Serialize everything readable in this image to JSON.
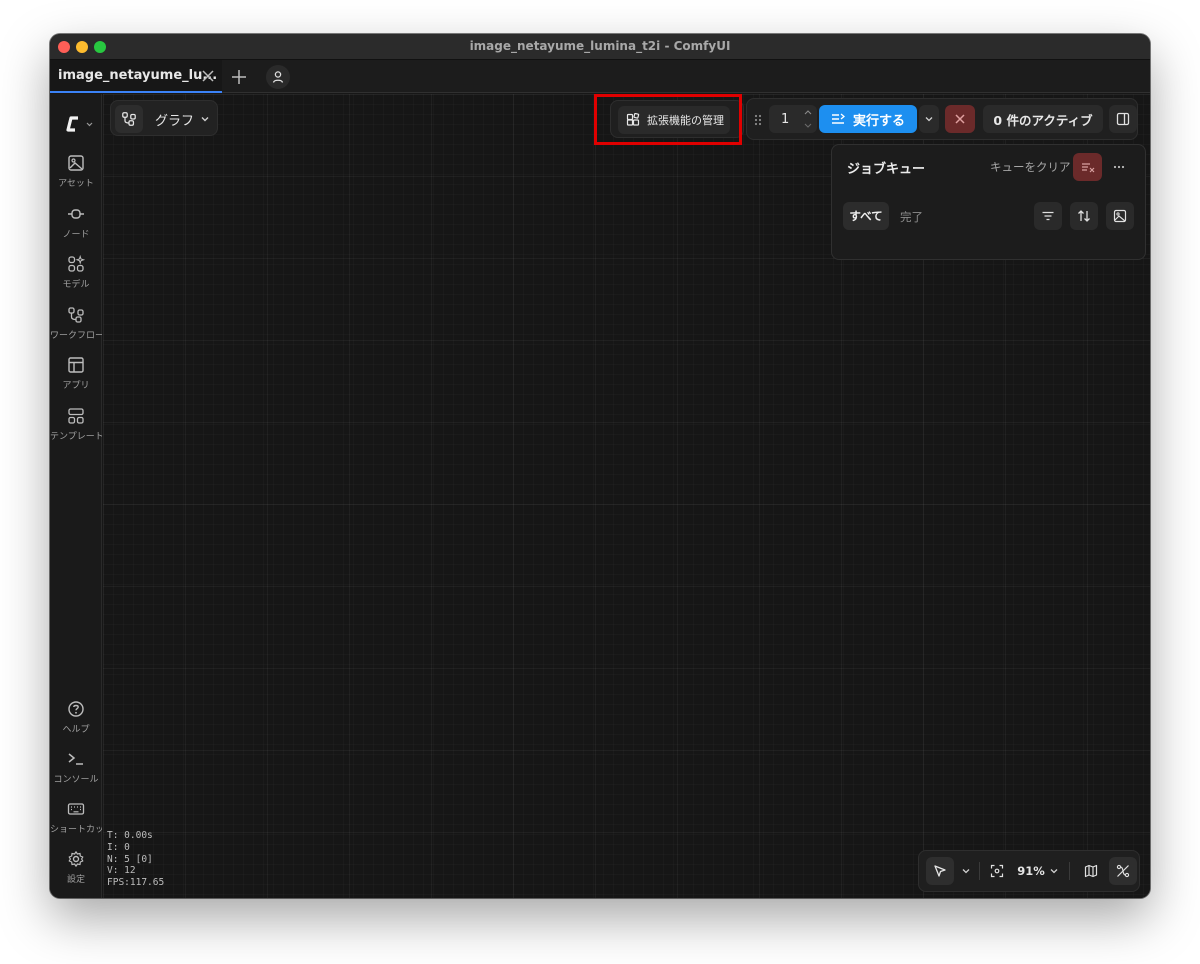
{
  "window": {
    "title": "image_netayume_lumina_t2i - ComfyUI"
  },
  "tabs": [
    {
      "label": "image_netayume_lu...",
      "active": true
    }
  ],
  "sidebar": {
    "items": [
      {
        "label": "アセット",
        "icon": "image-icon"
      },
      {
        "label": "ノード",
        "icon": "node-icon"
      },
      {
        "label": "モデル",
        "icon": "model-icon"
      },
      {
        "label": "ワークフロー",
        "icon": "workflow-icon"
      },
      {
        "label": "アプリ",
        "icon": "app-layout-icon"
      },
      {
        "label": "テンプレート",
        "icon": "template-icon"
      }
    ],
    "bottom_items": [
      {
        "label": "ヘルプ",
        "icon": "help-icon"
      },
      {
        "label": "コンソール",
        "icon": "terminal-icon"
      },
      {
        "label": "ショートカット",
        "icon": "keyboard-icon"
      },
      {
        "label": "設定",
        "icon": "gear-icon"
      }
    ]
  },
  "graph_selector": {
    "label": "グラフ"
  },
  "toolbar": {
    "extensions_label": "拡張機能の管理",
    "batch_count": "1",
    "run_label": "実行する",
    "active_label": "0 件のアクティブ"
  },
  "queue": {
    "title": "ジョブキュー",
    "clear_label": "キューをクリア",
    "filters": {
      "all": "すべて",
      "done": "完了"
    }
  },
  "stats": {
    "t": "T: 0.00s",
    "i": "I: 0",
    "n": "N: 5 [0]",
    "v": "V: 12",
    "fps": "FPS:117.65"
  },
  "canvas_controls": {
    "zoom": "91%"
  },
  "colors": {
    "accent": "#1d8ff0",
    "danger": "#6b2a2a",
    "highlight": "#e00000",
    "background": "#161616"
  }
}
